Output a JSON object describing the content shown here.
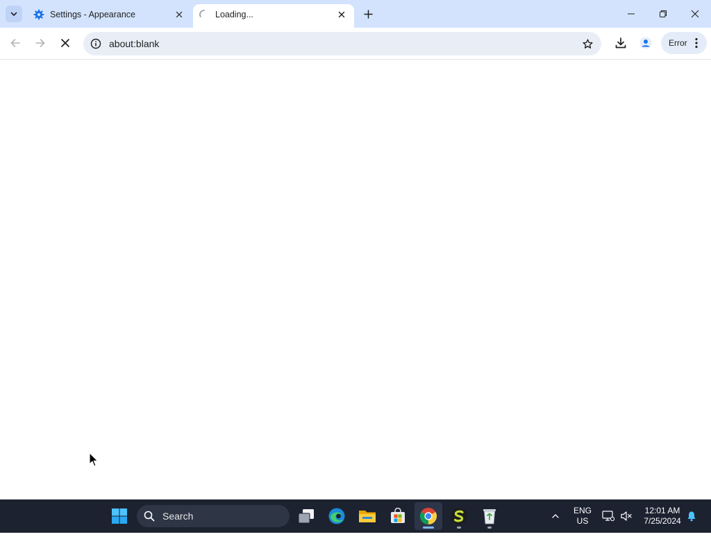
{
  "browser": {
    "tabs": [
      {
        "title": "Settings - Appearance",
        "icon": "gear-icon",
        "active": false
      },
      {
        "title": "Loading...",
        "icon": "loading-spinner-icon",
        "active": true
      }
    ],
    "address": "about:blank",
    "profile_chip_label": "Error"
  },
  "taskbar": {
    "search_label": "Search",
    "language_line1": "ENG",
    "language_line2": "US",
    "time": "12:01 AM",
    "date": "7/25/2024"
  },
  "colors": {
    "tabstrip_bg": "#d3e3fd",
    "omnibox_bg": "#e9eef6",
    "taskbar_bg": "#1c2230",
    "accent": "#1a73e8"
  }
}
